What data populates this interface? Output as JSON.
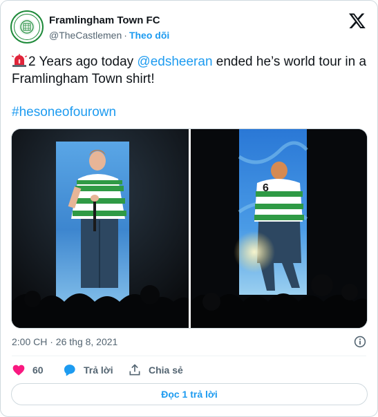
{
  "author": {
    "name": "Framlingham Town FC",
    "handle": "@TheCastlemen",
    "separator": "·",
    "follow_label": "Theo dõi"
  },
  "tweet": {
    "text_before_mention": "2 Years ago today ",
    "mention": "@edsheeran",
    "text_after_mention": " ended he’s world tour in a Framlingham Town shirt!",
    "hashtag": "#hesoneofourown",
    "emoji_icon": "police-siren-icon",
    "shirt_number": "6"
  },
  "meta": {
    "timestamp": "2:00 CH · 26 thg 8, 2021"
  },
  "actions": {
    "like_count": "60",
    "reply_label": "Trả lời",
    "share_label": "Chia sẻ"
  },
  "read_replies_label": "Đọc 1 trả lời",
  "colors": {
    "link": "#1d9bf0",
    "like": "#f91880",
    "club_green": "#1e8a3a",
    "stage_blue": "#3f8fe0"
  }
}
